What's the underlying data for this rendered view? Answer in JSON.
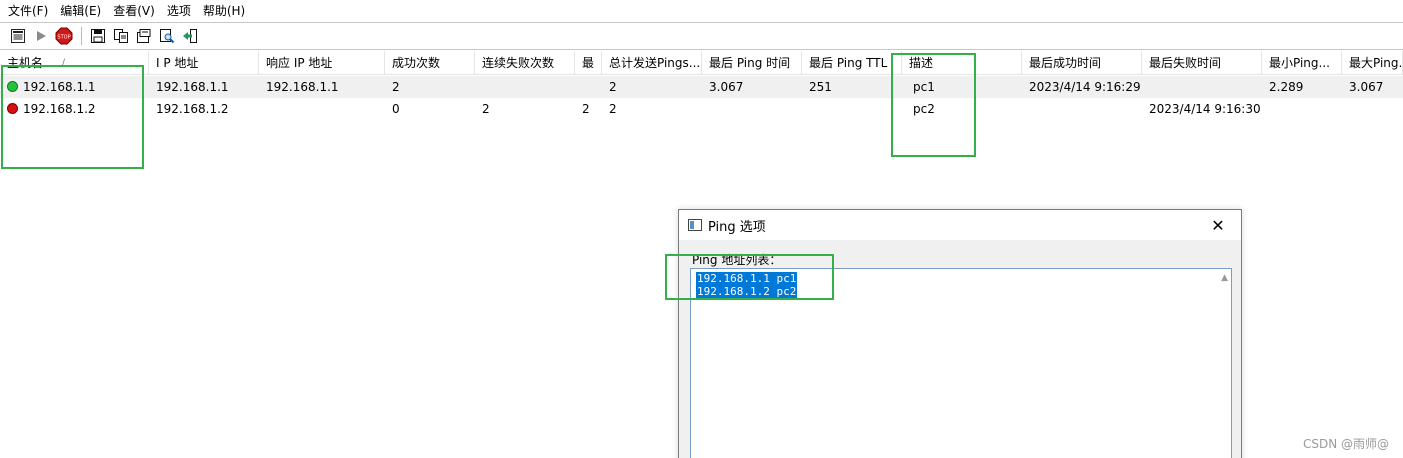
{
  "menu": [
    "文件(F)",
    "编辑(E)",
    "查看(V)",
    "选项",
    "帮助(H)"
  ],
  "toolbar": {
    "buttons": [
      "list-icon",
      "play-icon",
      "stop-icon",
      "save-icon",
      "copy-icon",
      "properties-icon",
      "find-icon",
      "exit-icon"
    ]
  },
  "table": {
    "columns": [
      "主机名",
      "I P 地址",
      "响应 IP 地址",
      "成功次数",
      "连续失败次数",
      "最",
      "总计发送Pings...",
      "最后 Ping 时间",
      "最后 Ping TTL",
      "描述",
      "最后成功时间",
      "最后失败时间",
      "最小Ping...",
      "最大Ping..."
    ],
    "sort_indicator": "/",
    "rows": [
      {
        "status": "success",
        "cells": [
          "192.168.1.1",
          "192.168.1.1",
          "192.168.1.1",
          "2",
          "",
          "",
          "2",
          "3.067",
          "251",
          "pc1",
          "2023/4/14 9:16:29",
          "",
          "2.289",
          "3.067"
        ]
      },
      {
        "status": "failed",
        "cells": [
          "192.168.1.2",
          "192.168.1.2",
          "",
          "0",
          "2",
          "2",
          "2",
          "",
          "",
          "pc2",
          "",
          "2023/4/14 9:16:30",
          "",
          ""
        ]
      }
    ]
  },
  "dialog": {
    "title": "Ping 选项",
    "close": "✕",
    "list_label": "Ping 地址列表：",
    "addresses": [
      "192.168.1.1 pc1",
      "192.168.1.2 pc2"
    ]
  },
  "colors": {
    "success": "#22c43a",
    "failed": "#d81010",
    "selection": "#0078d7",
    "annotation": "#33b04a"
  },
  "watermark": "CSDN @雨师@"
}
